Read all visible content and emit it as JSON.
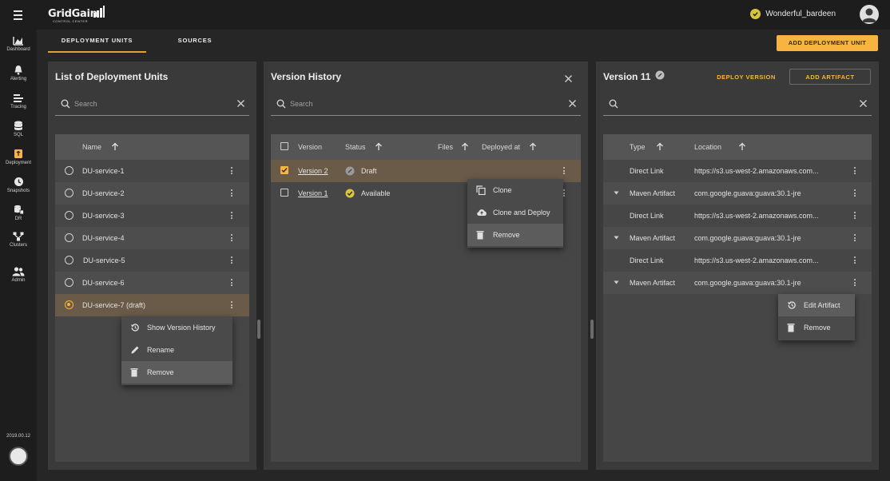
{
  "app": {
    "logo": "GridGain",
    "logo_sub": "CONTROL CENTER",
    "user_name": "Wonderful_bardeen",
    "version": "2019.00.12"
  },
  "sidebar": {
    "items": [
      {
        "label": "Dashboard",
        "icon": "chart-icon"
      },
      {
        "label": "Alerting",
        "icon": "bell-icon"
      },
      {
        "label": "Tracing",
        "icon": "tracing-icon"
      },
      {
        "label": "SQL",
        "icon": "database-icon"
      },
      {
        "label": "Deployment",
        "icon": "deployment-icon",
        "active": true
      },
      {
        "label": "Snapshots",
        "icon": "clock-icon"
      },
      {
        "label": "DR",
        "icon": "dr-icon"
      },
      {
        "label": "Clusters",
        "icon": "clusters-icon"
      },
      {
        "label": "Admin",
        "icon": "admin-icon"
      }
    ]
  },
  "tabs": [
    {
      "label": "DEPLOYMENT UNITS",
      "active": true
    },
    {
      "label": "SOURCES",
      "active": false
    }
  ],
  "actions": {
    "add_deployment_unit": "ADD DEPLOYMENT UNIT"
  },
  "panel_units": {
    "title": "List of Deployment Units",
    "search_placeholder": "Search",
    "column_name": "Name",
    "rows": [
      {
        "name": "DU-service-1"
      },
      {
        "name": "DU-service-2"
      },
      {
        "name": "DU-service-3"
      },
      {
        "name": "DU-service-4"
      },
      {
        "name": "DU-service-5"
      },
      {
        "name": "DU-service-6"
      },
      {
        "name": "DU-service-7 (draft)",
        "selected": true
      }
    ],
    "menu": [
      {
        "label": "Show Version History",
        "icon": "history-icon"
      },
      {
        "label": "Rename",
        "icon": "pencil-icon"
      },
      {
        "label": "Remove",
        "icon": "trash-icon",
        "highlighted": true
      }
    ]
  },
  "panel_versions": {
    "title": "Version History",
    "search_placeholder": "Search",
    "columns": {
      "version": "Version",
      "status": "Status",
      "files": "Files",
      "deployed_at": "Deployed at"
    },
    "rows": [
      {
        "version": "Version 2",
        "status": "Draft",
        "checked": true
      },
      {
        "version": "Version 1",
        "status": "Available",
        "checked": false
      }
    ],
    "menu": [
      {
        "label": "Clone",
        "icon": "copy-icon"
      },
      {
        "label": "Clone and Deploy",
        "icon": "cloud-upload-icon"
      },
      {
        "label": "Remove",
        "icon": "trash-icon",
        "highlighted": true
      }
    ]
  },
  "panel_version_detail": {
    "title": "Version 11",
    "deploy_version": "DEPLOY VERSION",
    "add_artifact": "ADD ARTIFACT",
    "search_placeholder": "",
    "columns": {
      "type": "Type",
      "location": "Location"
    },
    "rows": [
      {
        "type": "Direct Link",
        "location": "https://s3.us-west-2.amazonaws.com...",
        "expand": false
      },
      {
        "type": "Maven Artifact",
        "location": "com.google.guava:guava:30.1-jre",
        "expand": true
      },
      {
        "type": "Direct Link",
        "location": "https://s3.us-west-2.amazonaws.com...",
        "expand": false
      },
      {
        "type": "Maven Artifact",
        "location": "com.google.guava:guava:30.1-jre",
        "expand": true
      },
      {
        "type": "Direct Link",
        "location": "https://s3.us-west-2.amazonaws.com...",
        "expand": false
      },
      {
        "type": "Maven Artifact",
        "location": "com.google.guava:guava:30.1-jre",
        "expand": true
      }
    ],
    "menu": [
      {
        "label": "Edit Artifact",
        "icon": "history-icon",
        "highlighted": true
      },
      {
        "label": "Remove",
        "icon": "trash-icon"
      }
    ]
  },
  "colors": {
    "accent": "#f7b440",
    "selected_row": "#6a5a48",
    "status_available": "#d8c53a",
    "status_draft": "#9a9a9a"
  }
}
